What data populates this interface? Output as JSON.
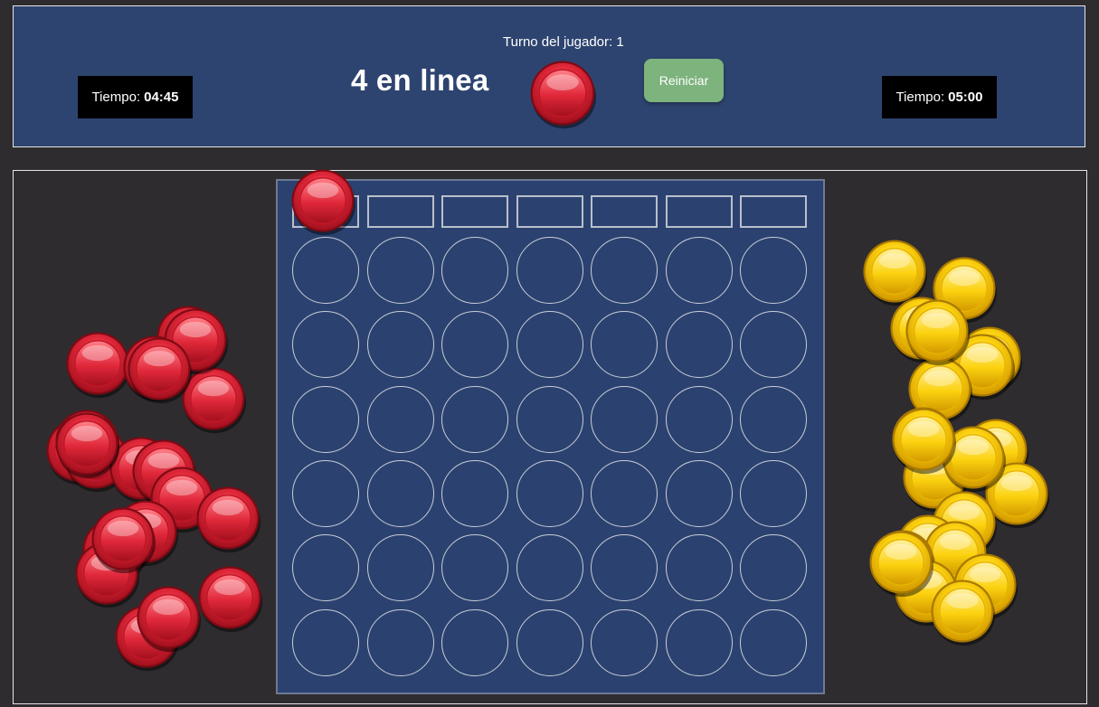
{
  "header": {
    "title": "4 en linea",
    "turn_label": "Turno del jugador: 1",
    "reset_label": "Reiniciar",
    "timer_left": {
      "label": "Tiempo:",
      "value": "04:45"
    },
    "timer_right": {
      "label": "Tiempo:",
      "value": "05:00"
    },
    "current_player_chip": "red"
  },
  "board": {
    "columns": 7,
    "rows": 6,
    "cells": [
      [
        "",
        "",
        "",
        "",
        "",
        "",
        ""
      ],
      [
        "",
        "",
        "",
        "",
        "",
        "",
        ""
      ],
      [
        "",
        "",
        "",
        "",
        "",
        "",
        ""
      ],
      [
        "",
        "",
        "",
        "",
        "",
        "",
        ""
      ],
      [
        "",
        "",
        "",
        "",
        "",
        "",
        ""
      ],
      [
        "",
        "",
        "",
        "",
        "",
        "",
        ""
      ]
    ],
    "hover_column": 1,
    "hover_chip": "red"
  },
  "piles": {
    "red": {
      "count": 21
    },
    "yellow": {
      "count": 21
    }
  },
  "colors": {
    "red_chip": "#d8202f",
    "yellow_chip": "#f7c600",
    "header_bg": "#2e4470",
    "board_bg": "#2b4270",
    "reset_button": "#7db37d"
  }
}
